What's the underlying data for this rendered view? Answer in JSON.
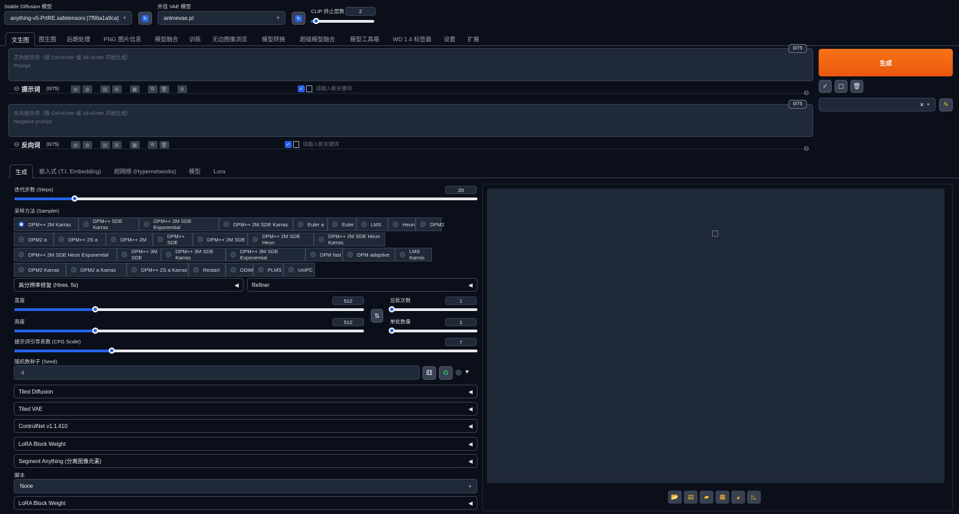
{
  "top": {
    "model_label": "Stable Diffusion 模型",
    "model_value": "anything-v5-PrtRE.safetensors [7f96a1a9ca]",
    "vae_label": "外挂 VAE 模型",
    "vae_value": "animevae.pt",
    "clip_label": "CLIP 终止层数",
    "clip_value": "2",
    "clip_level": 0.08
  },
  "tabs": [
    "文生图",
    "图生图",
    "后期处理",
    "PNG 图片信息",
    "模型融合",
    "训练",
    "无边图像浏览",
    "模型转换",
    "超级模型融合",
    "模型工具箱",
    "WD 1.4 标签器",
    "设置",
    "扩展"
  ],
  "prompt": {
    "placeholder_line1": "正向提示词（按 Ctrl+Enter 或 Alt+Enter 开始生成）",
    "placeholder_line2": "Prompt",
    "counter": "0/75",
    "label": "提示词",
    "token_count": "(0/75)",
    "keyword_placeholder": "请输入新关键词"
  },
  "negative": {
    "placeholder_line1": "反向提示词（按 Ctrl+Enter 或 Alt+Enter 开始生成）",
    "placeholder_line2": "Negative prompt",
    "counter": "0/75",
    "label": "反向词",
    "token_count": "(0/75)",
    "keyword_placeholder": "请输入新关键词"
  },
  "generate_label": "生成",
  "subtabs": [
    "生成",
    "嵌入式 (T.I. Embedding)",
    "超网络 (Hypernetworks)",
    "模型",
    "Lora"
  ],
  "steps": {
    "label": "迭代步数 (Steps)",
    "value": "20",
    "level": 0.13
  },
  "sampler": {
    "label": "采样方法 (Sampler)",
    "selected": "DPM++ 2M Karras",
    "rows": [
      [
        "DPM++ 2M Karras",
        "DPM++ SDE Karras",
        "DPM++ 2M SDE Exponential",
        "DPM++ 2M SDE Karras",
        "Euler a",
        "Euler",
        "LMS",
        "Heun",
        "DPM2"
      ],
      [
        "DPM2 a",
        "DPM++ 2S a",
        "DPM++ 2M",
        "DPM++ SDE",
        "DPM++ 2M SDE",
        "DPM++ 2M SDE Heun",
        "DPM++ 2M SDE Heun Karras"
      ],
      [
        "DPM++ 2M SDE Heun Exponential",
        "DPM++ 3M SDE",
        "DPM++ 3M SDE Karras",
        "DPM++ 3M SDE Exponential",
        "DPM fast",
        "DPM adaptive",
        "LMS Karras"
      ],
      [
        "DPM2 Karras",
        "DPM2 a Karras",
        "DPM++ 2S a Karras",
        "Restart",
        "DDIM",
        "PLMS",
        "UniPC"
      ]
    ]
  },
  "hires_label": "高分辨率修复 (Hires. fix)",
  "refiner_label": "Refiner",
  "width": {
    "label": "宽度",
    "value": "512",
    "level": 0.23
  },
  "height": {
    "label": "高度",
    "value": "512",
    "level": 0.23
  },
  "batch_count": {
    "label": "总批次数",
    "value": "1",
    "level": 0.0
  },
  "batch_size": {
    "label": "单批数量",
    "value": "1",
    "level": 0.0
  },
  "cfg": {
    "label": "提示词引导系数 (CFG Scale)",
    "value": "7",
    "level": 0.21
  },
  "seed": {
    "label": "随机数种子 (Seed)",
    "value": "-1"
  },
  "accordions": [
    "Tiled Diffusion",
    "Tiled VAE",
    "ControlNet v1.1.410",
    "LoRA Block Weight",
    "Segment Anything (分离图像元素)"
  ],
  "script": {
    "label": "脚本",
    "value": "None"
  },
  "last_accordion": "LoRA Block Weight"
}
